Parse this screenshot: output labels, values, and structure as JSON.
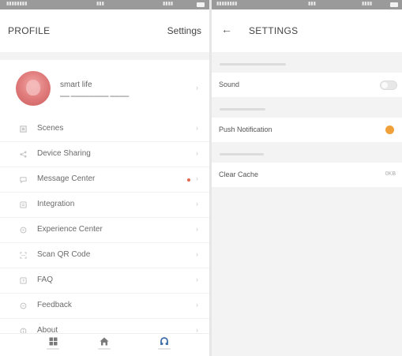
{
  "colors": {
    "accent": "#f0a13a",
    "badge": "#e06a4a",
    "avatar": "#e27f7f"
  },
  "left": {
    "header": {
      "title": "PROFILE",
      "settings_label": "Settings"
    },
    "profile": {
      "name": "smart life"
    },
    "menu": [
      {
        "label": "Scenes",
        "icon": "scenes-icon"
      },
      {
        "label": "Device Sharing",
        "icon": "share-icon"
      },
      {
        "label": "Message Center",
        "icon": "message-icon",
        "badge": true
      },
      {
        "label": "Integration",
        "icon": "integration-icon"
      },
      {
        "label": "Experience Center",
        "icon": "experience-icon"
      },
      {
        "label": "Scan QR Code",
        "icon": "qr-code-icon"
      },
      {
        "label": "FAQ",
        "icon": "faq-icon"
      },
      {
        "label": "Feedback",
        "icon": "feedback-icon"
      },
      {
        "label": "About",
        "icon": "info-icon"
      }
    ],
    "tabbar": [
      {
        "icon": "grid-icon",
        "active": false
      },
      {
        "icon": "home-icon",
        "active": false
      },
      {
        "icon": "profile-icon",
        "active": true
      }
    ]
  },
  "right": {
    "header": {
      "title": "SETTINGS"
    },
    "rows": [
      {
        "label": "Sound",
        "control": "toggle",
        "state": "off"
      },
      {
        "label": "Push Notification",
        "control": "toggle",
        "state": "on"
      },
      {
        "label": "Clear Cache",
        "control": "value",
        "value": "0KB"
      }
    ]
  }
}
